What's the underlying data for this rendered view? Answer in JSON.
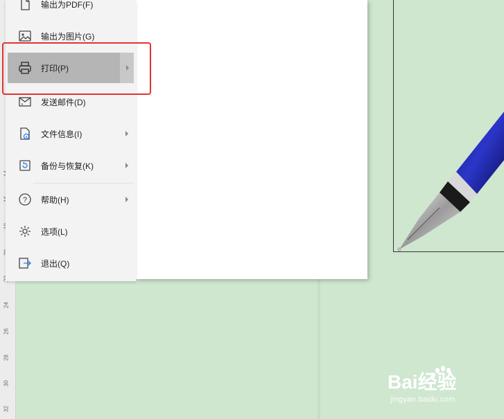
{
  "ruler": {
    "ticks": [
      "14",
      "16",
      "18",
      "20",
      "22",
      "24",
      "26",
      "28",
      "30",
      "32"
    ]
  },
  "menu": {
    "items": [
      {
        "label": "输出为PDF(F)",
        "icon": "pdf-export-icon",
        "has_arrow": false
      },
      {
        "label": "输出为图片(G)",
        "icon": "image-export-icon",
        "has_arrow": false
      },
      {
        "label": "打印(P)",
        "icon": "printer-icon",
        "has_arrow": true,
        "state": "hover"
      },
      {
        "label": "发送邮件(D)",
        "icon": "mail-icon",
        "has_arrow": false
      },
      {
        "label": "文件信息(I)",
        "icon": "file-info-icon",
        "has_arrow": true
      },
      {
        "label": "备份与恢复(K)",
        "icon": "backup-restore-icon",
        "has_arrow": true
      },
      {
        "label": "帮助(H)",
        "icon": "help-icon",
        "has_arrow": true
      },
      {
        "label": "选项(L)",
        "icon": "gear-icon",
        "has_arrow": false
      },
      {
        "label": "退出(Q)",
        "icon": "exit-icon",
        "has_arrow": false
      }
    ]
  },
  "watermark": {
    "brand": "Bai经验",
    "url": "jingyan.baidu.com"
  },
  "colors": {
    "highlight": "#e0332f",
    "doc_background": "#cfe6cf",
    "hover": "#b5b5b5"
  }
}
